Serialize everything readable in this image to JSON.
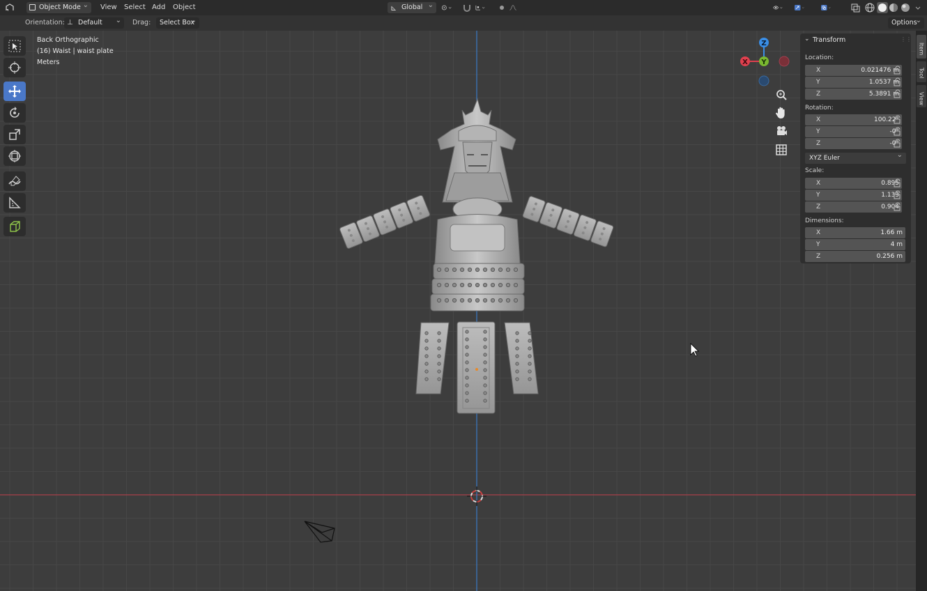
{
  "header": {
    "mode": "Object Mode",
    "menus": [
      "View",
      "Select",
      "Add",
      "Object"
    ],
    "transform_orientation": "Global",
    "options_label": "Options"
  },
  "tool_header": {
    "orientation_label": "Orientation:",
    "orientation_value": "Default",
    "drag_label": "Drag:",
    "drag_value": "Select Box"
  },
  "viewport": {
    "view_name": "Back Orthographic",
    "object_info": "(16) Waist | waist plate",
    "units": "Meters"
  },
  "gizmo": {
    "z": "Z",
    "y": "Y",
    "x": "X"
  },
  "side_tabs": [
    "Item",
    "Tool",
    "View"
  ],
  "transform_panel": {
    "title": "Transform",
    "location_label": "Location:",
    "location": [
      {
        "axis": "X",
        "value": "0.021476 m"
      },
      {
        "axis": "Y",
        "value": "1.0537 m"
      },
      {
        "axis": "Z",
        "value": "5.3891 m"
      }
    ],
    "rotation_label": "Rotation:",
    "rotation": [
      {
        "axis": "X",
        "value": "100.22°"
      },
      {
        "axis": "Y",
        "value": "-0°"
      },
      {
        "axis": "Z",
        "value": "-0°"
      }
    ],
    "rotation_mode": "XYZ Euler",
    "scale_label": "Scale:",
    "scale": [
      {
        "axis": "X",
        "value": "0.895"
      },
      {
        "axis": "Y",
        "value": "1.133"
      },
      {
        "axis": "Z",
        "value": "0.904"
      }
    ],
    "dimensions_label": "Dimensions:",
    "dimensions": [
      {
        "axis": "X",
        "value": "1.66 m"
      },
      {
        "axis": "Y",
        "value": "4 m"
      },
      {
        "axis": "Z",
        "value": "0.256 m"
      }
    ]
  },
  "colors": {
    "accent_blue": "#4a78c8",
    "x_axis_line": "#c0404a",
    "y_axis_line": "#3a7ac8",
    "gizmo_x": "#e0404e",
    "gizmo_y": "#7ab830",
    "gizmo_z": "#3a8ee6"
  }
}
